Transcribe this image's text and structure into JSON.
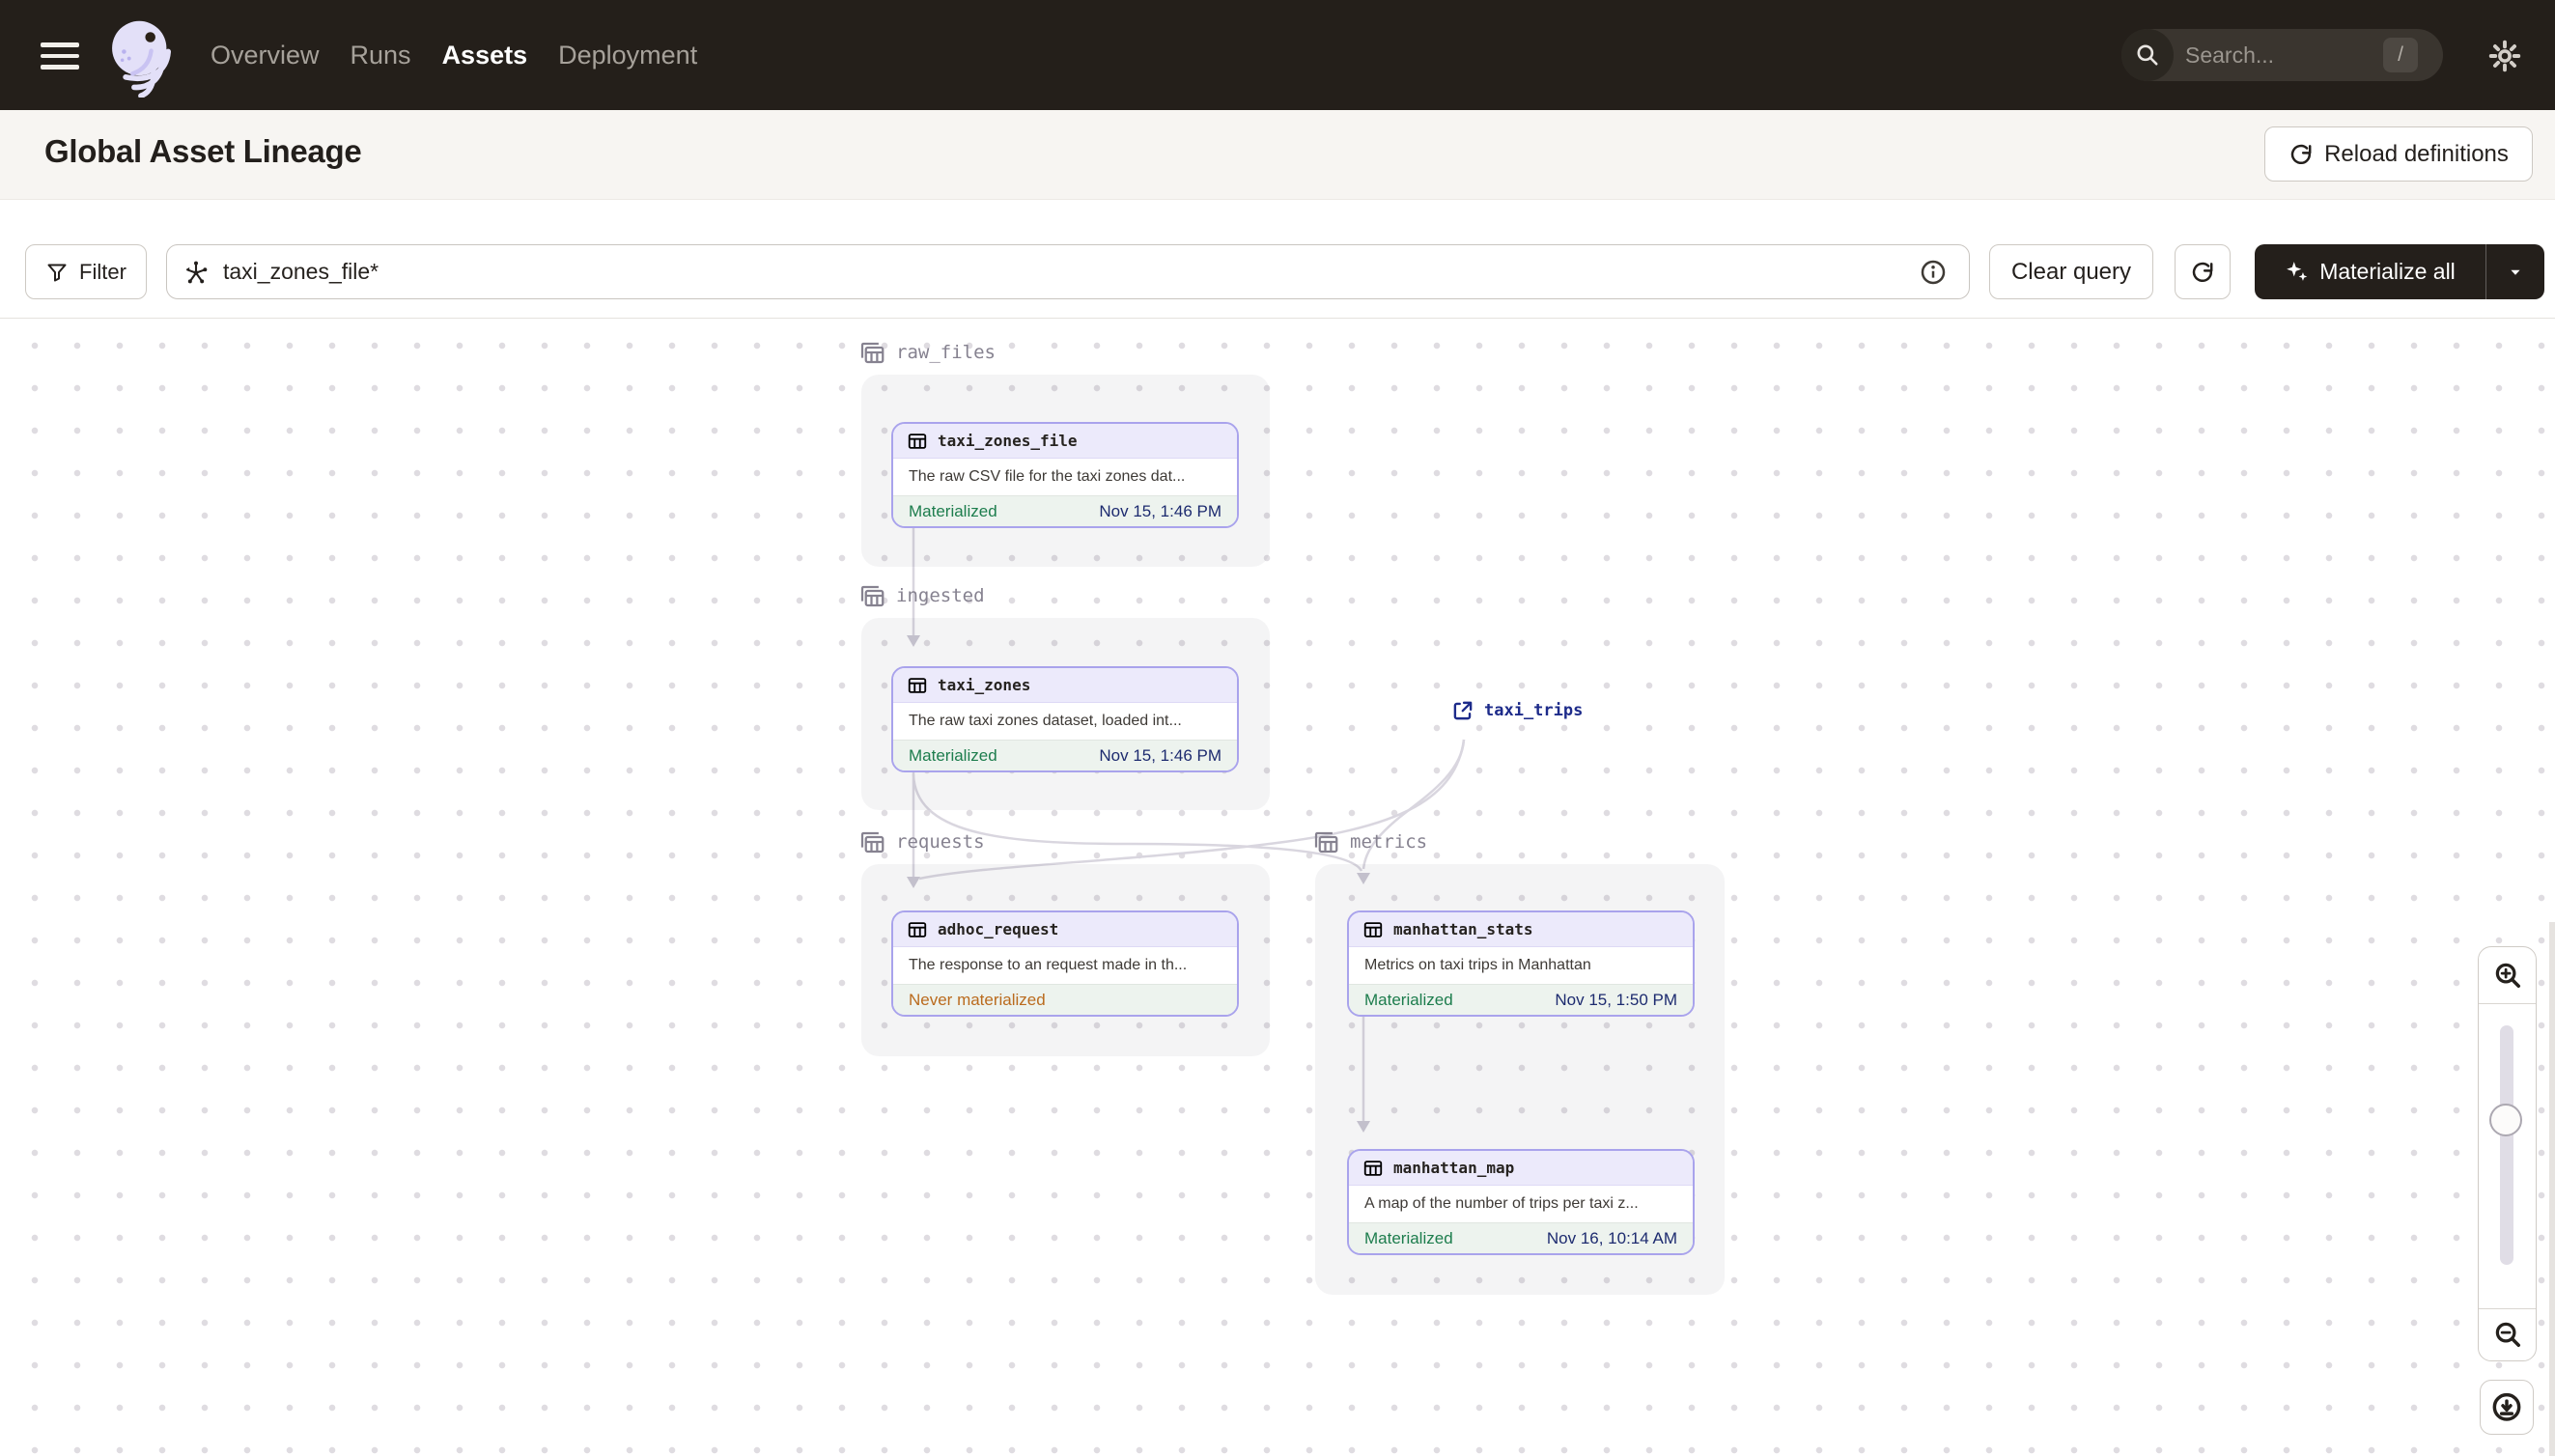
{
  "nav": {
    "items": [
      {
        "label": "Overview",
        "active": false
      },
      {
        "label": "Runs",
        "active": false
      },
      {
        "label": "Assets",
        "active": true
      },
      {
        "label": "Deployment",
        "active": false
      }
    ],
    "search": {
      "placeholder": "Search...",
      "shortcut_key": "/"
    }
  },
  "header": {
    "title": "Global Asset Lineage",
    "reload_button_label": "Reload definitions"
  },
  "toolbar": {
    "filter_button_label": "Filter",
    "query_input_value": "taxi_zones_file*",
    "clear_query_button_label": "Clear query",
    "materialize_button_label": "Materialize all"
  },
  "lineage": {
    "groups": [
      {
        "name": "raw_files"
      },
      {
        "name": "ingested"
      },
      {
        "name": "requests"
      },
      {
        "name": "metrics"
      }
    ],
    "nodes": [
      {
        "name": "taxi_zones_file",
        "group": "raw_files",
        "description": "The raw CSV file for the taxi zones dat...",
        "status": "Materialized",
        "timestamp": "Nov 15, 1:46 PM"
      },
      {
        "name": "taxi_zones",
        "group": "ingested",
        "description": "The raw taxi zones dataset, loaded int...",
        "status": "Materialized",
        "timestamp": "Nov 15, 1:46 PM"
      },
      {
        "name": "adhoc_request",
        "group": "requests",
        "description": "The response to an request made in th...",
        "status": "Never materialized",
        "timestamp": ""
      },
      {
        "name": "manhattan_stats",
        "group": "metrics",
        "description": "Metrics on taxi trips in Manhattan",
        "status": "Materialized",
        "timestamp": "Nov 15, 1:50 PM"
      },
      {
        "name": "manhattan_map",
        "group": "metrics",
        "description": "A map of the number of trips per taxi z...",
        "status": "Materialized",
        "timestamp": "Nov 16, 10:14 AM"
      }
    ],
    "external_assets": [
      {
        "name": "taxi_trips"
      }
    ],
    "edges": [
      {
        "from": "taxi_zones_file",
        "to": "taxi_zones"
      },
      {
        "from": "taxi_zones",
        "to": "adhoc_request"
      },
      {
        "from": "taxi_zones",
        "to": "manhattan_stats"
      },
      {
        "from": "taxi_trips",
        "to": "adhoc_request"
      },
      {
        "from": "taxi_trips",
        "to": "manhattan_stats"
      },
      {
        "from": "manhattan_stats",
        "to": "manhattan_map"
      }
    ]
  },
  "colors": {
    "nav_bg": "#241F1A",
    "dark_btn_bg": "#241F1B",
    "accent_lavender": "#A9A3EC",
    "node_header_bg": "#ECEAFB",
    "node_footer_bg": "#EDF3EE",
    "status_materialized": "#1D7D4D",
    "status_never_materialized": "#BA6B1E",
    "timestamp_text": "#1D2B6F",
    "external_asset_text": "#1D2B8A",
    "edge": "#D9D6DF"
  }
}
